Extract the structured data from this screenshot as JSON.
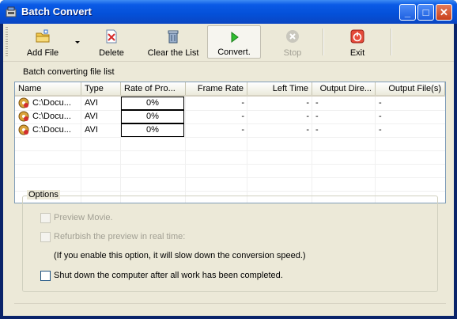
{
  "window": {
    "title": "Batch Convert"
  },
  "toolbar": {
    "add_file": "Add File",
    "delete": "Delete",
    "clear_list": "Clear the List",
    "convert": "Convert.",
    "stop": "Stop",
    "exit": "Exit"
  },
  "list": {
    "caption": "Batch converting file list",
    "columns": [
      "Name",
      "Type",
      "Rate of Pro...",
      "Frame Rate",
      "Left Time",
      "Output Dire...",
      "Output File(s)"
    ],
    "rows": [
      {
        "name": "C:\\Docu...",
        "type": "AVI",
        "progress": "0%",
        "frame_rate": "-",
        "left_time": "-",
        "output_dir": "-",
        "output_files": "-"
      },
      {
        "name": "C:\\Docu...",
        "type": "AVI",
        "progress": "0%",
        "frame_rate": "-",
        "left_time": "-",
        "output_dir": "-",
        "output_files": "-"
      },
      {
        "name": "C:\\Docu...",
        "type": "AVI",
        "progress": "0%",
        "frame_rate": "-",
        "left_time": "-",
        "output_dir": "-",
        "output_files": "-"
      }
    ]
  },
  "options": {
    "title": "Options",
    "preview_movie": "Preview Movie.",
    "refurbish": "Refurbish the preview in real time:",
    "refurbish_note": "(If you enable this option, it will slow down the conversion speed.)",
    "shutdown": "Shut down the computer after all work has been completed."
  },
  "colors": {
    "titlebar": "#0a5ae6",
    "face": "#ece9d8",
    "listborder": "#7f9db9"
  },
  "icons": [
    "app-icon",
    "add-file-icon",
    "delete-icon",
    "clear-list-icon",
    "convert-icon",
    "stop-icon",
    "exit-icon",
    "video-file-icon"
  ]
}
